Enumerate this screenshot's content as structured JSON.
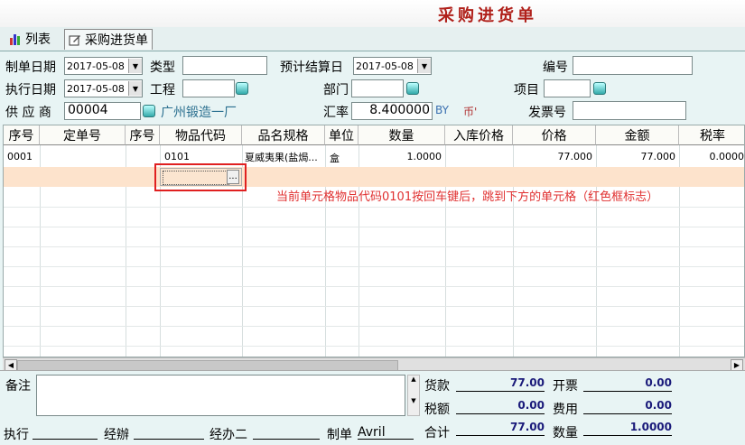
{
  "window": {
    "title": "采购进货单"
  },
  "tabs": [
    {
      "label": "列表"
    },
    {
      "label": "采购进货单"
    }
  ],
  "form": {
    "create_date_label": "制单日期",
    "create_date_value": "2017-05-08",
    "type_label": "类型",
    "type_value": "",
    "settle_date_label": "预计结算日",
    "settle_date_value": "2017-05-08",
    "number_label": "编号",
    "number_value": "",
    "exec_date_label": "执行日期",
    "exec_date_value": "2017-05-08",
    "project_label": "工程",
    "project_value": "",
    "dept_label": "部门",
    "dept_value": "",
    "item_label": "项目",
    "item_value": "",
    "supplier_label": "供 应 商",
    "supplier_code": "00004",
    "supplier_name": "广州锻造一厂",
    "rate_label": "汇率",
    "rate_value": "8.400000",
    "currency_value": "BY",
    "currency_unit": "币'",
    "invoice_label": "发票号",
    "invoice_value": ""
  },
  "grid": {
    "columns": [
      "序号",
      "定单号",
      "序号",
      "物品代码",
      "品名规格",
      "单位",
      "数量",
      "入库价格",
      "价格",
      "金额",
      "税率"
    ],
    "rows": [
      {
        "seq": "0001",
        "order_no": "",
        "seq2": "",
        "item_code": "0101",
        "name_spec": "夏威夷果(盐焗...",
        "unit": "盒",
        "qty": "1.0000",
        "in_price": "",
        "price": "77.000",
        "amount": "77.000",
        "tax_rate": "0.0000"
      }
    ],
    "editor_button": "...",
    "annotation": "当前单元格物品代码0101按回车键后，跳到下方的单元格（红色框标志）",
    "annotation_color": "#e03030"
  },
  "bottom": {
    "remark_label": "备注",
    "remark_value": "",
    "goods_label": "货款",
    "goods_value": "77.00",
    "invoice_open_label": "开票",
    "invoice_open_value": "0.00",
    "tax_label": "税额",
    "tax_value": "0.00",
    "fee_label": "费用",
    "fee_value": "0.00",
    "total_label": "合计",
    "total_value": "77.00",
    "qty_label": "数量",
    "qty_value": "1.0000",
    "exec_label": "执行",
    "handler_label": "经辦",
    "handler2_label": "经办二",
    "maker_label": "制单",
    "maker_value": "Avril"
  }
}
